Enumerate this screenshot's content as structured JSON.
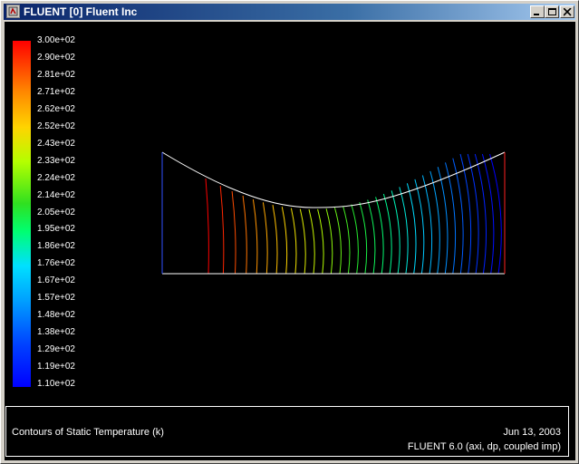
{
  "window": {
    "title": "FLUENT [0] Fluent Inc",
    "icon": "fluent-app-icon",
    "controls": [
      "minimize-icon",
      "maximize-icon",
      "close-icon"
    ]
  },
  "colorbar": {
    "labels": [
      "3.00e+02",
      "2.90e+02",
      "2.81e+02",
      "2.71e+02",
      "2.62e+02",
      "2.52e+02",
      "2.43e+02",
      "2.33e+02",
      "2.24e+02",
      "2.14e+02",
      "2.05e+02",
      "1.95e+02",
      "1.86e+02",
      "1.76e+02",
      "1.67e+02",
      "1.57e+02",
      "1.48e+02",
      "1.38e+02",
      "1.29e+02",
      "1.19e+02",
      "1.10e+02"
    ],
    "max": 300,
    "min": 110
  },
  "plot": {
    "description_colors": {
      "outline": "#ffffff",
      "left_edge": "#3050ff",
      "right_edge": "#ff2020"
    }
  },
  "footer": {
    "title": "Contours of Static Temperature (k)",
    "date": "Jun 13, 2003",
    "version": "FLUENT 6.0 (axi, dp, coupled imp)"
  }
}
